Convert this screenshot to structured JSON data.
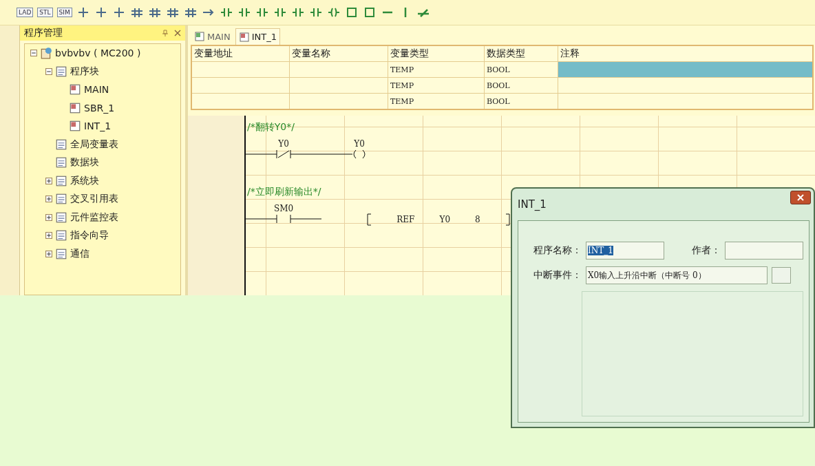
{
  "toolbar": {
    "mode_buttons": [
      "LAD",
      "STL",
      "SIM"
    ]
  },
  "program_panel": {
    "title": "程序管理",
    "tree": [
      {
        "label": "bvbvbv ( MC200 )",
        "expanded": true,
        "children": [
          {
            "label": "程序块",
            "expanded": true,
            "children": [
              {
                "label": "MAIN"
              },
              {
                "label": "SBR_1"
              },
              {
                "label": "INT_1"
              }
            ]
          },
          {
            "label": "全局变量表"
          },
          {
            "label": "数据块"
          },
          {
            "label": "系统块",
            "expanded": false
          },
          {
            "label": "交叉引用表",
            "expanded": false
          },
          {
            "label": "元件监控表",
            "expanded": false
          },
          {
            "label": "指令向导",
            "expanded": false
          },
          {
            "label": "通信",
            "expanded": false
          }
        ]
      }
    ]
  },
  "editor_tabs": [
    {
      "label": "MAIN",
      "selected": false
    },
    {
      "label": "INT_1",
      "selected": true
    }
  ],
  "variable_table": {
    "columns": [
      "变量地址",
      "变量名称",
      "变量类型",
      "数据类型",
      "注释"
    ],
    "rows": [
      {
        "cells": [
          "",
          "",
          "TEMP",
          "BOOL",
          ""
        ],
        "selected": true
      },
      {
        "cells": [
          "",
          "",
          "TEMP",
          "BOOL",
          ""
        ],
        "selected": false
      },
      {
        "cells": [
          "",
          "",
          "TEMP",
          "BOOL",
          ""
        ],
        "selected": false
      }
    ]
  },
  "ladder": [
    {
      "comment": "/*翻转Y0*/",
      "elements": [
        {
          "kind": "contact_nc",
          "operand": "Y0"
        },
        {
          "kind": "coil",
          "operand": "Y0"
        }
      ]
    },
    {
      "comment": "/*立即刷新输出*/",
      "elements": [
        {
          "kind": "contact_no",
          "operand": "SM0"
        },
        {
          "kind": "box",
          "operands": [
            "REF",
            "Y0",
            "8"
          ]
        }
      ]
    }
  ],
  "dialog": {
    "title": "INT_1",
    "fields": [
      {
        "label": "程序名称：",
        "value": "INT_1",
        "selected": true
      },
      {
        "label": "作者："
      },
      {
        "label": "中断事件：",
        "value": "X0输入上升沿中断（中断号 0）"
      }
    ]
  }
}
